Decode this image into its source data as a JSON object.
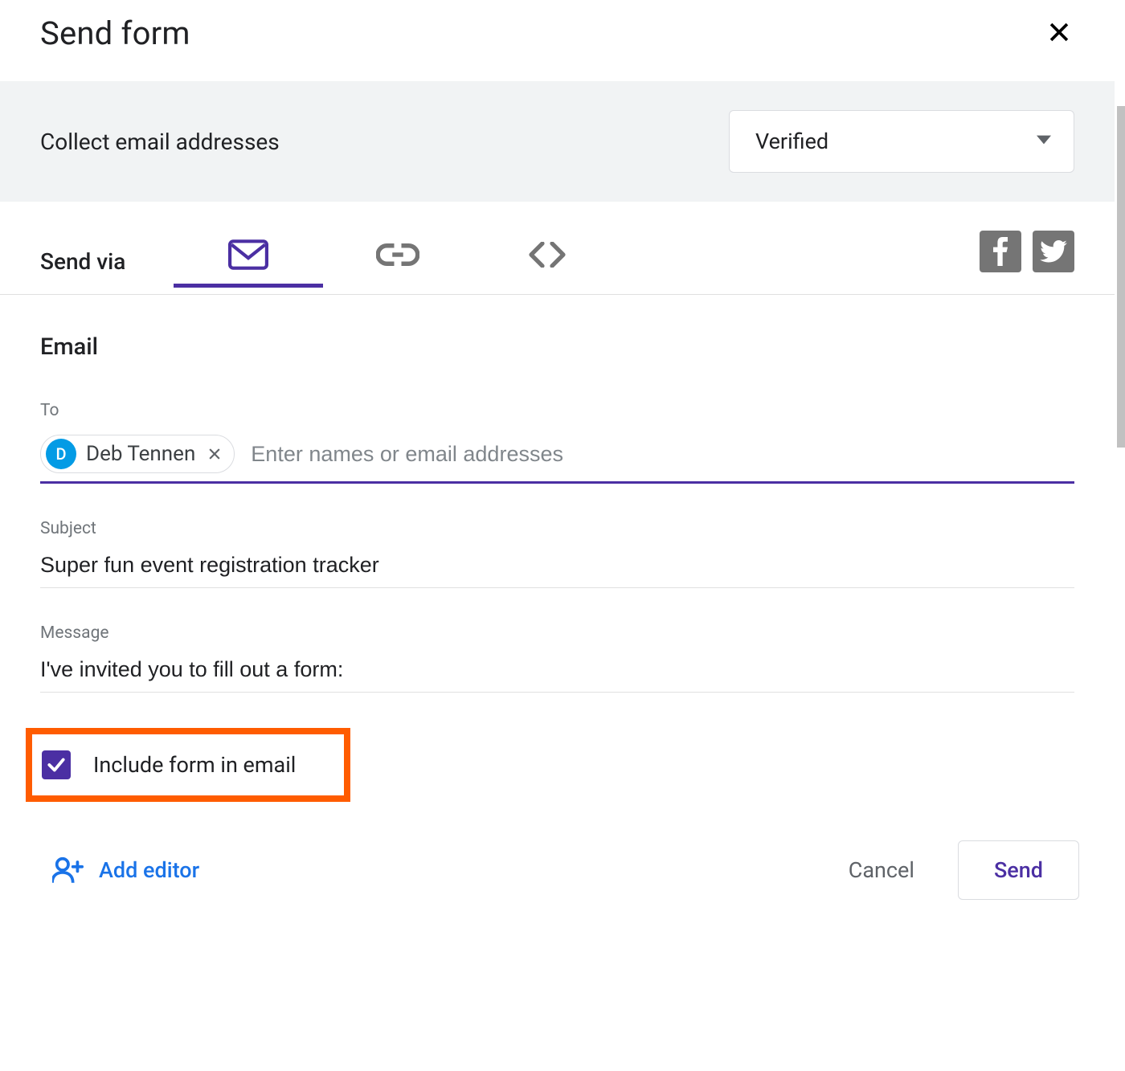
{
  "header": {
    "title": "Send form"
  },
  "collect": {
    "label": "Collect email addresses",
    "selected": "Verified"
  },
  "sendvia": {
    "label": "Send via"
  },
  "email": {
    "heading": "Email",
    "to_label": "To",
    "to_placeholder": "Enter names or email addresses",
    "chip": {
      "initial": "D",
      "name": "Deb Tennen"
    },
    "subject_label": "Subject",
    "subject_value": "Super fun event registration tracker",
    "message_label": "Message",
    "message_value": "I've invited you to fill out a form:",
    "include_label": "Include form in email"
  },
  "footer": {
    "add_editor": "Add editor",
    "cancel": "Cancel",
    "send": "Send"
  }
}
